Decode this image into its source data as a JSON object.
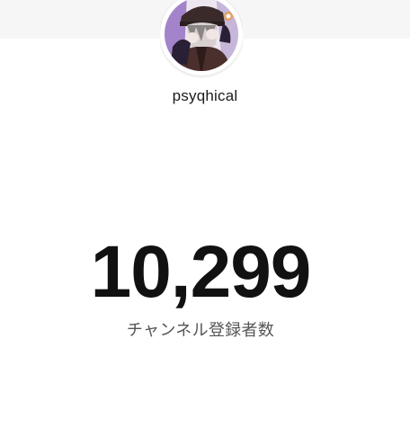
{
  "channel": {
    "name": "psyqhical",
    "avatar_icon": "channel-avatar"
  },
  "subscribers": {
    "count": "10,299",
    "label": "チャンネル登録者数"
  },
  "colors": {
    "top_band": "#f6f6f6",
    "background": "#ffffff",
    "count_text": "#111111",
    "label_text": "#555555"
  }
}
